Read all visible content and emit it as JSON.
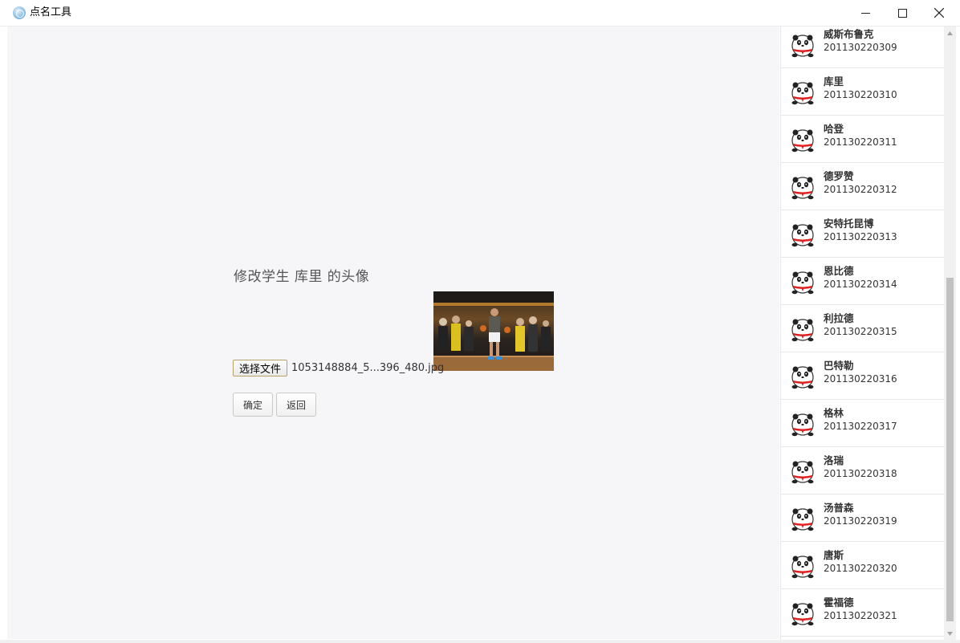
{
  "window": {
    "title": "点名工具",
    "icon": "app-globe-icon"
  },
  "main": {
    "heading": "修改学生 库里 的头像",
    "file": {
      "choose_label": "选择文件",
      "file_name": "1053148884_5...396_480.jpg"
    },
    "buttons": {
      "ok_label": "确定",
      "back_label": "返回"
    }
  },
  "students": [
    {
      "name": "威斯布鲁克",
      "id": "201130220309"
    },
    {
      "name": "库里",
      "id": "201130220310"
    },
    {
      "name": "哈登",
      "id": "201130220311"
    },
    {
      "name": "德罗赞",
      "id": "201130220312"
    },
    {
      "name": "安特托昆博",
      "id": "201130220313"
    },
    {
      "name": "恩比德",
      "id": "201130220314"
    },
    {
      "name": "利拉德",
      "id": "201130220315"
    },
    {
      "name": "巴特勒",
      "id": "201130220316"
    },
    {
      "name": "格林",
      "id": "201130220317"
    },
    {
      "name": "洛瑞",
      "id": "201130220318"
    },
    {
      "name": "汤普森",
      "id": "201130220319"
    },
    {
      "name": "唐斯",
      "id": "201130220320"
    },
    {
      "name": "霍福德",
      "id": "201130220321"
    }
  ],
  "colors": {
    "main_bg": "#f6f6f8",
    "panel_bg": "#ffffff",
    "divider": "#e6e6e6"
  }
}
